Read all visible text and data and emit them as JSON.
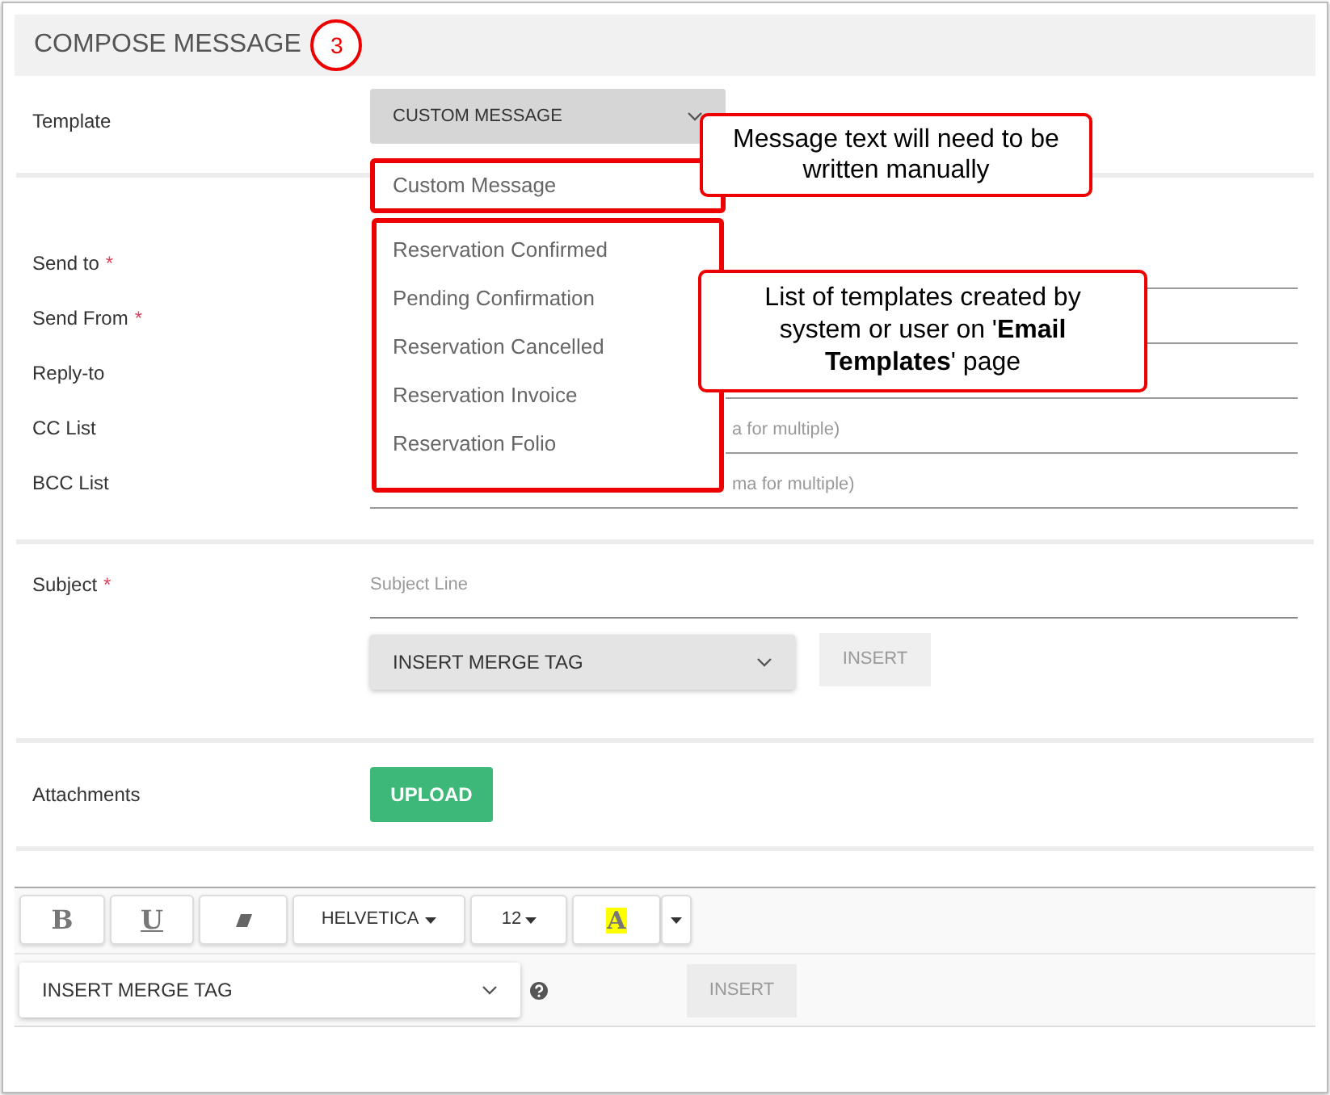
{
  "section": {
    "title": "COMPOSE MESSAGE",
    "step_badge": "3"
  },
  "template": {
    "label": "Template",
    "value": "CUSTOM MESSAGE",
    "options": [
      {
        "label": "Custom Message"
      },
      {
        "label": "Reservation Confirmed"
      },
      {
        "label": "Pending Confirmation"
      },
      {
        "label": "Reservation Cancelled"
      },
      {
        "label": "Reservation Invoice"
      },
      {
        "label": "Reservation Folio"
      }
    ]
  },
  "recipients": [
    {
      "label": "Send to",
      "required_mark": "*"
    },
    {
      "label": "Send From",
      "required_mark": "*"
    },
    {
      "label": "Reply-to"
    },
    {
      "label": "CC List",
      "placeholder": "a for multiple)"
    },
    {
      "label": "BCC List",
      "placeholder": "ma for multiple)"
    }
  ],
  "subject": {
    "label": "Subject",
    "required_mark": "*",
    "placeholder": "Subject Line",
    "merge_tag": "INSERT MERGE TAG",
    "insert": "INSERT"
  },
  "attachments": {
    "label": "Attachments",
    "button": "UPLOAD"
  },
  "editor": {
    "toolbar": [
      {
        "kind": "bold",
        "label": "B"
      },
      {
        "kind": "underline",
        "label": "U"
      },
      {
        "kind": "eraser"
      },
      {
        "kind": "font",
        "label": "HELVETICA"
      },
      {
        "kind": "size",
        "label": "12"
      },
      {
        "kind": "color",
        "label": "A"
      }
    ],
    "merge_tag": "INSERT MERGE TAG",
    "insert": "INSERT"
  },
  "callouts": [
    {
      "text": "Message text will need to be written manually"
    },
    {
      "text": "List of templates created by system or user on '**Email Templates**' page"
    }
  ]
}
